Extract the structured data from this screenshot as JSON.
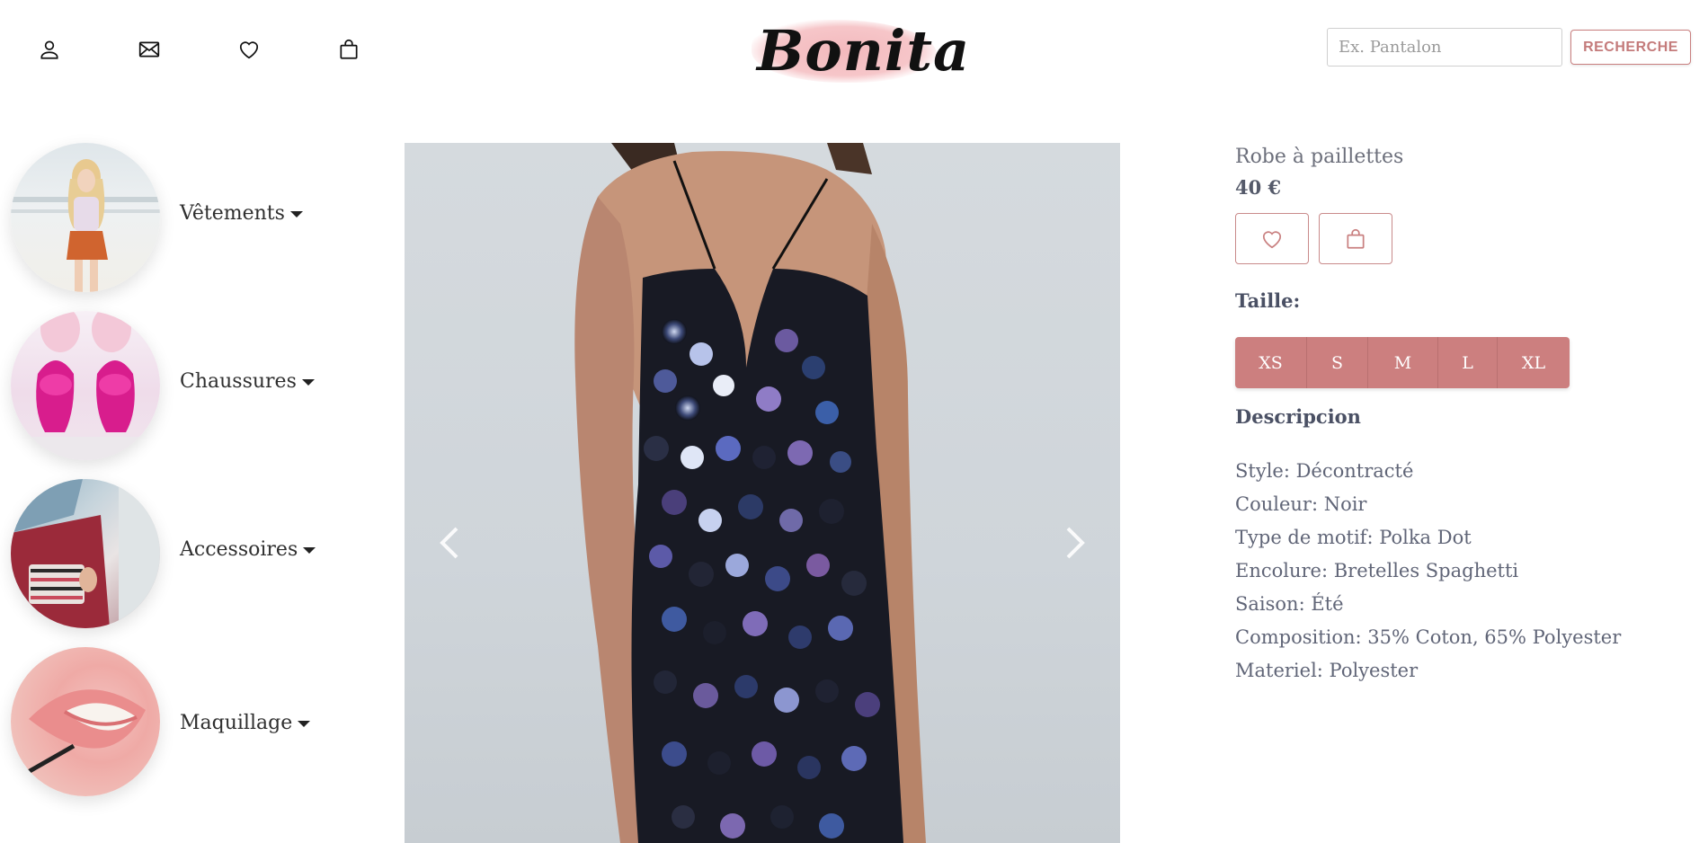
{
  "header": {
    "icons": [
      "user-icon",
      "mail-icon",
      "heart-icon",
      "shopping-bag-icon"
    ],
    "logo_text": "Bonita",
    "search": {
      "placeholder": "Ex. Pantalon",
      "button_label": "RECHERCHE"
    }
  },
  "sidebar": {
    "categories": [
      {
        "label": "Vêtements"
      },
      {
        "label": "Chaussures"
      },
      {
        "label": "Accessoires"
      },
      {
        "label": "Maquillage"
      }
    ]
  },
  "product": {
    "title": "Robe à paillettes",
    "price": "40 €",
    "size_label": "Taille:",
    "sizes": [
      "XS",
      "S",
      "M",
      "L",
      "XL"
    ],
    "description_title": "Descripcion",
    "description": [
      "Style: Décontracté",
      "Couleur: Noir",
      "Type de motif: Polka Dot",
      "Encolure: Bretelles Spaghetti",
      "Saison: Été",
      "Composition: 35% Coton, 65% Polyester",
      "Materiel: Polyester"
    ]
  },
  "colors": {
    "accent": "#cc7f7f",
    "accent_border": "#c97f7f",
    "logo_brush": "#f3b9bd",
    "text_muted": "#606577"
  }
}
